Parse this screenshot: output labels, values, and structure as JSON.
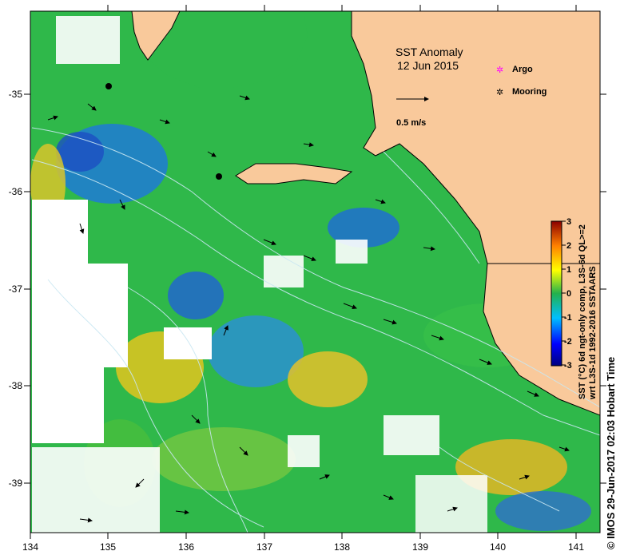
{
  "map": {
    "title": "SST Anomaly",
    "date": "12 Jun 2015",
    "scale_label": "0.5 m/s",
    "legend": [
      {
        "label": "Argo",
        "symbol": "magenta-star"
      },
      {
        "label": "Mooring",
        "symbol": "black-star"
      }
    ],
    "x_ticks": [
      "134",
      "135",
      "136",
      "137",
      "138",
      "139",
      "140",
      "141"
    ],
    "y_ticks": [
      "-35",
      "-36",
      "-37",
      "-38",
      "-39"
    ],
    "colorbar": {
      "ticks": [
        "3",
        "2",
        "1",
        "0",
        "-1",
        "-2",
        "-3"
      ],
      "caption_line1": "SST (°C) 6d ngt-only comp, L3S-6d QL>=2",
      "caption_line2": "wrt L3S-1d 1992-2016 SSTAARS"
    },
    "credit": "© IMOS 29-Jun-2017 02:03 Hobart Time",
    "colors": {
      "land": "#f9c99b",
      "sea_neutral": "#2fb84a",
      "cold": "#1e5fc9",
      "warm": "#e8c320",
      "argo": "#ff00ff"
    }
  }
}
